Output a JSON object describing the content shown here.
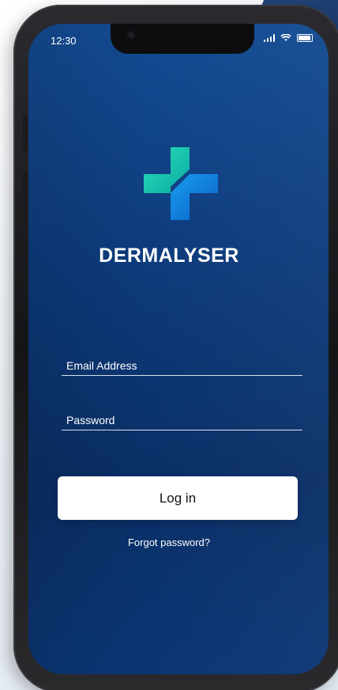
{
  "status_bar": {
    "time": "12:30"
  },
  "app": {
    "brand_name": "DERMALYSER"
  },
  "login_form": {
    "email_label": "Email Address",
    "password_label": "Password",
    "login_button_label": "Log in",
    "forgot_password_label": "Forgot password?"
  },
  "theme": {
    "primary_blue": "#0b3675",
    "accent_teal": "#1fd1b4",
    "accent_blue": "#1487e8"
  }
}
